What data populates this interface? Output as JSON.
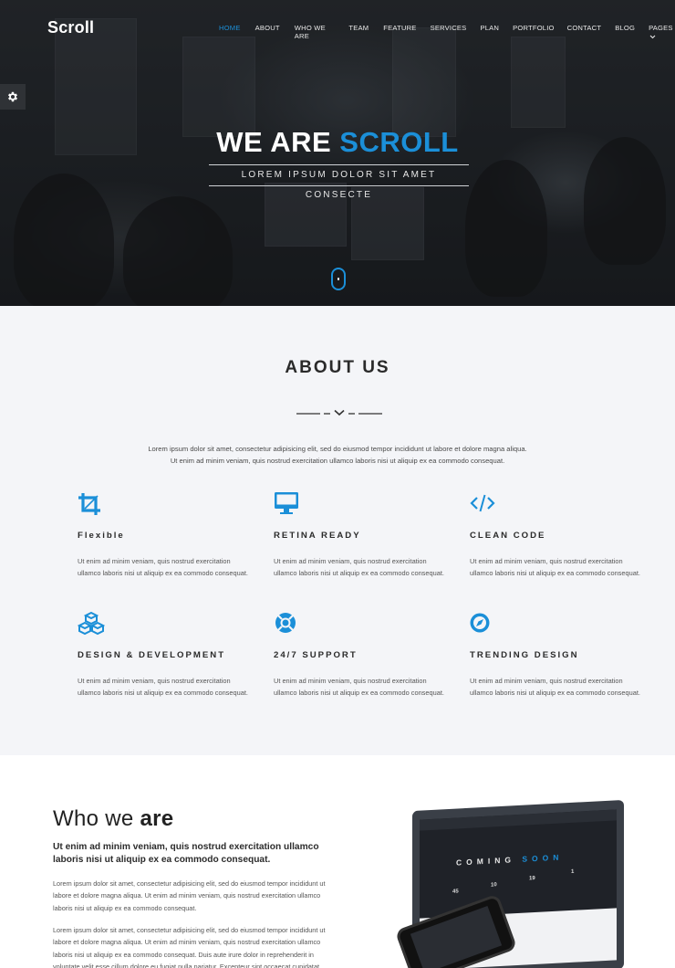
{
  "brand": {
    "logo_text": "Scroll",
    "accent_color": "#1b8fd8"
  },
  "nav": {
    "items": [
      {
        "label": "HOME",
        "active": true
      },
      {
        "label": "ABOUT",
        "active": false
      },
      {
        "label": "WHO WE ARE",
        "active": false
      },
      {
        "label": "TEAM",
        "active": false
      },
      {
        "label": "FEATURE",
        "active": false
      },
      {
        "label": "SERVICES",
        "active": false
      },
      {
        "label": "PLAN",
        "active": false
      },
      {
        "label": "PORTFOLIO",
        "active": false
      },
      {
        "label": "CONTACT",
        "active": false
      },
      {
        "label": "BLOG",
        "active": false
      },
      {
        "label": "PAGES",
        "active": false
      }
    ]
  },
  "hero": {
    "title_part1": "WE ARE ",
    "title_part2": "SCROLL",
    "subtitle": "LOREM IPSUM DOLOR SIT AMET CONSECTE"
  },
  "about": {
    "title": "ABOUT US",
    "intro_line1": "Lorem ipsum dolor sit amet, consectetur adipisicing elit, sed do eiusmod tempor incididunt ut labore et dolore magna aliqua.",
    "intro_line2": "Ut enim ad minim veniam, quis nostrud exercitation ullamco laboris nisi ut aliquip ex ea commodo consequat.",
    "features": [
      {
        "icon": "crop-icon",
        "title": "Flexible",
        "text": "Ut enim ad minim veniam, quis nostrud exercitation ullamco laboris nisi ut aliquip ex ea commodo consequat."
      },
      {
        "icon": "monitor-icon",
        "title": "RETINA READY",
        "text": "Ut enim ad minim veniam, quis nostrud exercitation ullamco laboris nisi ut aliquip ex ea commodo consequat."
      },
      {
        "icon": "code-icon",
        "title": "CLEAN CODE",
        "text": "Ut enim ad minim veniam, quis nostrud exercitation ullamco laboris nisi ut aliquip ex ea commodo consequat."
      },
      {
        "icon": "cubes-icon",
        "title": "DESIGN & DEVELOPMENT",
        "text": "Ut enim ad minim veniam, quis nostrud exercitation ullamco laboris nisi ut aliquip ex ea commodo consequat."
      },
      {
        "icon": "lifebuoy-icon",
        "title": "24/7 SUPPORT",
        "text": "Ut enim ad minim veniam, quis nostrud exercitation ullamco laboris nisi ut aliquip ex ea commodo consequat."
      },
      {
        "icon": "compass-icon",
        "title": "TRENDING DESIGN",
        "text": "Ut enim ad minim veniam, quis nostrud exercitation ullamco laboris nisi ut aliquip ex ea commodo consequat."
      }
    ]
  },
  "who": {
    "title_light": "Who we ",
    "title_bold": "are",
    "lead": "Ut enim ad minim veniam, quis nostrud exercitation ullamco laboris nisi ut aliquip ex ea commodo consequat.",
    "para1": "Lorem ipsum dolor sit amet, consectetur adipisicing elit, sed do eiusmod tempor incididunt ut labore et dolore magna aliqua. Ut enim ad minim veniam, quis nostrud exercitation ullamco laboris nisi ut aliquip ex ea commodo consequat.",
    "para2": "Lorem ipsum dolor sit amet, consectetur adipisicing elit, sed do eiusmod tempor incididunt ut labore et dolore magna aliqua. Ut enim ad minim veniam, quis nostrud exercitation ullamco laboris nisi ut aliquip ex ea commodo consequat. Duis aute irure dolor in reprehenderit in voluptate velit esse cillum dolore eu fugiat nulla pariatur. Excepteur sint occaecat cupidatat",
    "mockup": {
      "coming": "COMING ",
      "soon": "SOON",
      "counters": [
        "45",
        "10",
        "19",
        "1"
      ]
    }
  }
}
